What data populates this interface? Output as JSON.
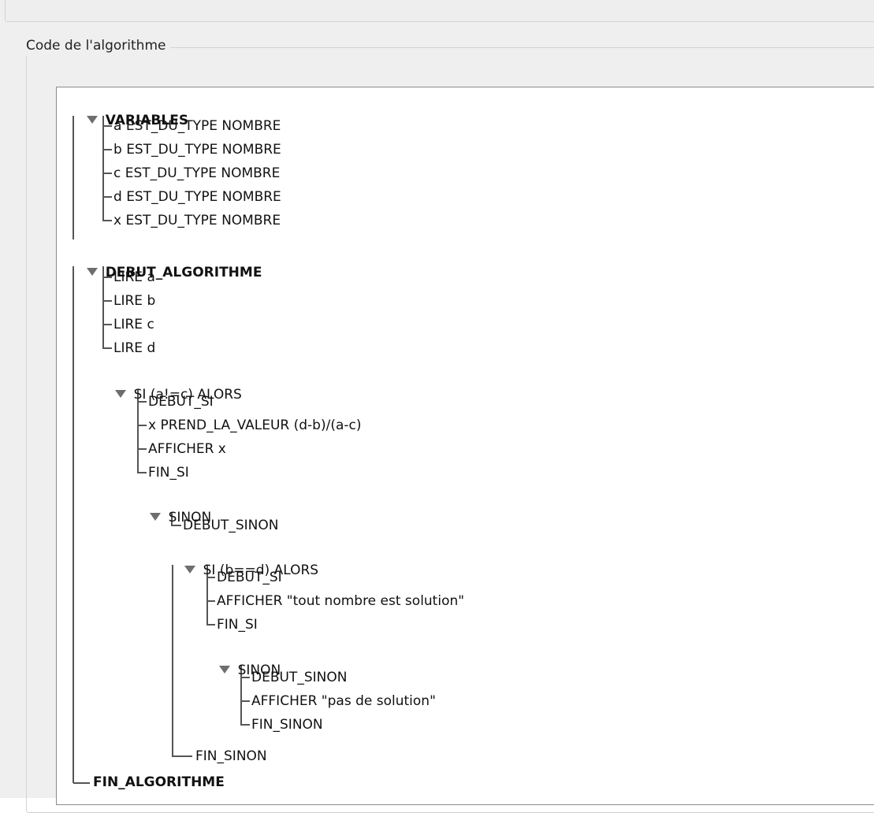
{
  "panel": {
    "title": "Code de l'algorithme"
  },
  "tree": {
    "variables": {
      "label": "VARIABLES",
      "items": [
        "a EST_DU_TYPE NOMBRE",
        "b EST_DU_TYPE NOMBRE",
        "c EST_DU_TYPE NOMBRE",
        "d EST_DU_TYPE NOMBRE",
        "x EST_DU_TYPE NOMBRE"
      ]
    },
    "debut": {
      "label": "DEBUT_ALGORITHME",
      "lire": [
        "LIRE a",
        "LIRE b",
        "LIRE c",
        "LIRE d"
      ],
      "si1": {
        "label": "SI (a!=c) ALORS",
        "items": [
          "DEBUT_SI",
          "x PREND_LA_VALEUR (d-b)/(a-c)",
          "AFFICHER x",
          "FIN_SI"
        ],
        "sinon": {
          "label": "SINON",
          "debut": "DEBUT_SINON",
          "si2": {
            "label": "SI (b==d) ALORS",
            "items": [
              "DEBUT_SI",
              "AFFICHER \"tout nombre est solution\"",
              "FIN_SI"
            ],
            "sinon": {
              "label": "SINON",
              "items": [
                "DEBUT_SINON",
                "AFFICHER \"pas de solution\"",
                "FIN_SINON"
              ]
            }
          },
          "fin": "FIN_SINON"
        }
      }
    },
    "fin": {
      "label": "FIN_ALGORITHME"
    }
  },
  "colors": {
    "tree_lines": "#555555",
    "expander": "#6e6e6e",
    "panel_bg": "#efefef",
    "tree_bg": "#ffffff"
  }
}
